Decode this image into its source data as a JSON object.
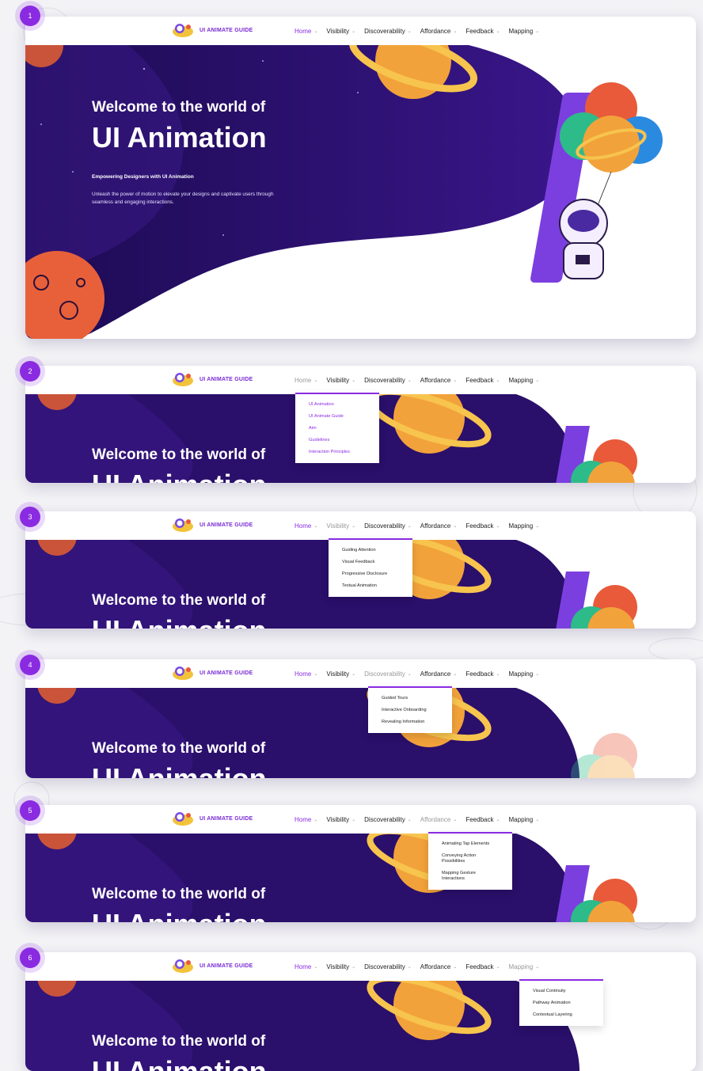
{
  "nav": {
    "logo_text": "UI ANIMATE GUIDE",
    "menu": [
      "Home",
      "Visibility",
      "Discoverability",
      "Affordance",
      "Feedback",
      "Mapping"
    ]
  },
  "hero": {
    "welcome": "Welcome to the world of",
    "title": "UI Animation",
    "subtitle": "Empowering Designers with UI Animation",
    "description": "Unleash the power of motion to elevate your designs and captivate users through seamless and engaging interactions."
  },
  "panels": [
    {
      "badge": "1",
      "active_menu": "Home",
      "dropdown": []
    },
    {
      "badge": "2",
      "active_menu": "Home",
      "dropdown": [
        "UI Animation",
        "UI Animate Guide",
        "Aim",
        "Guidelines",
        "Interaction Principles"
      ]
    },
    {
      "badge": "3",
      "active_menu": "Visibility",
      "dropdown": [
        "Guiding Attention",
        "Visual Feedback",
        "Progressive Disclosure",
        "Textual Animation"
      ]
    },
    {
      "badge": "4",
      "active_menu": "Discoverability",
      "dropdown": [
        "Guided Tours",
        "Interactive Onboarding",
        "Revealing Information"
      ]
    },
    {
      "badge": "5",
      "active_menu": "Affordance",
      "dropdown": [
        "Animating Tap Elements",
        "Conveying Action Possibilities",
        "Mapping Gesture Interactions"
      ]
    },
    {
      "badge": "6",
      "active_menu": "Mapping",
      "dropdown": [
        "Visual Continuity",
        "Pathway Animation",
        "Contextual Layering"
      ]
    }
  ],
  "colors": {
    "accent": "#8a2be2",
    "hero_bg": "#2a0f6b",
    "planet_orange": "#f2a23a",
    "planet_red": "#e85a3a"
  }
}
